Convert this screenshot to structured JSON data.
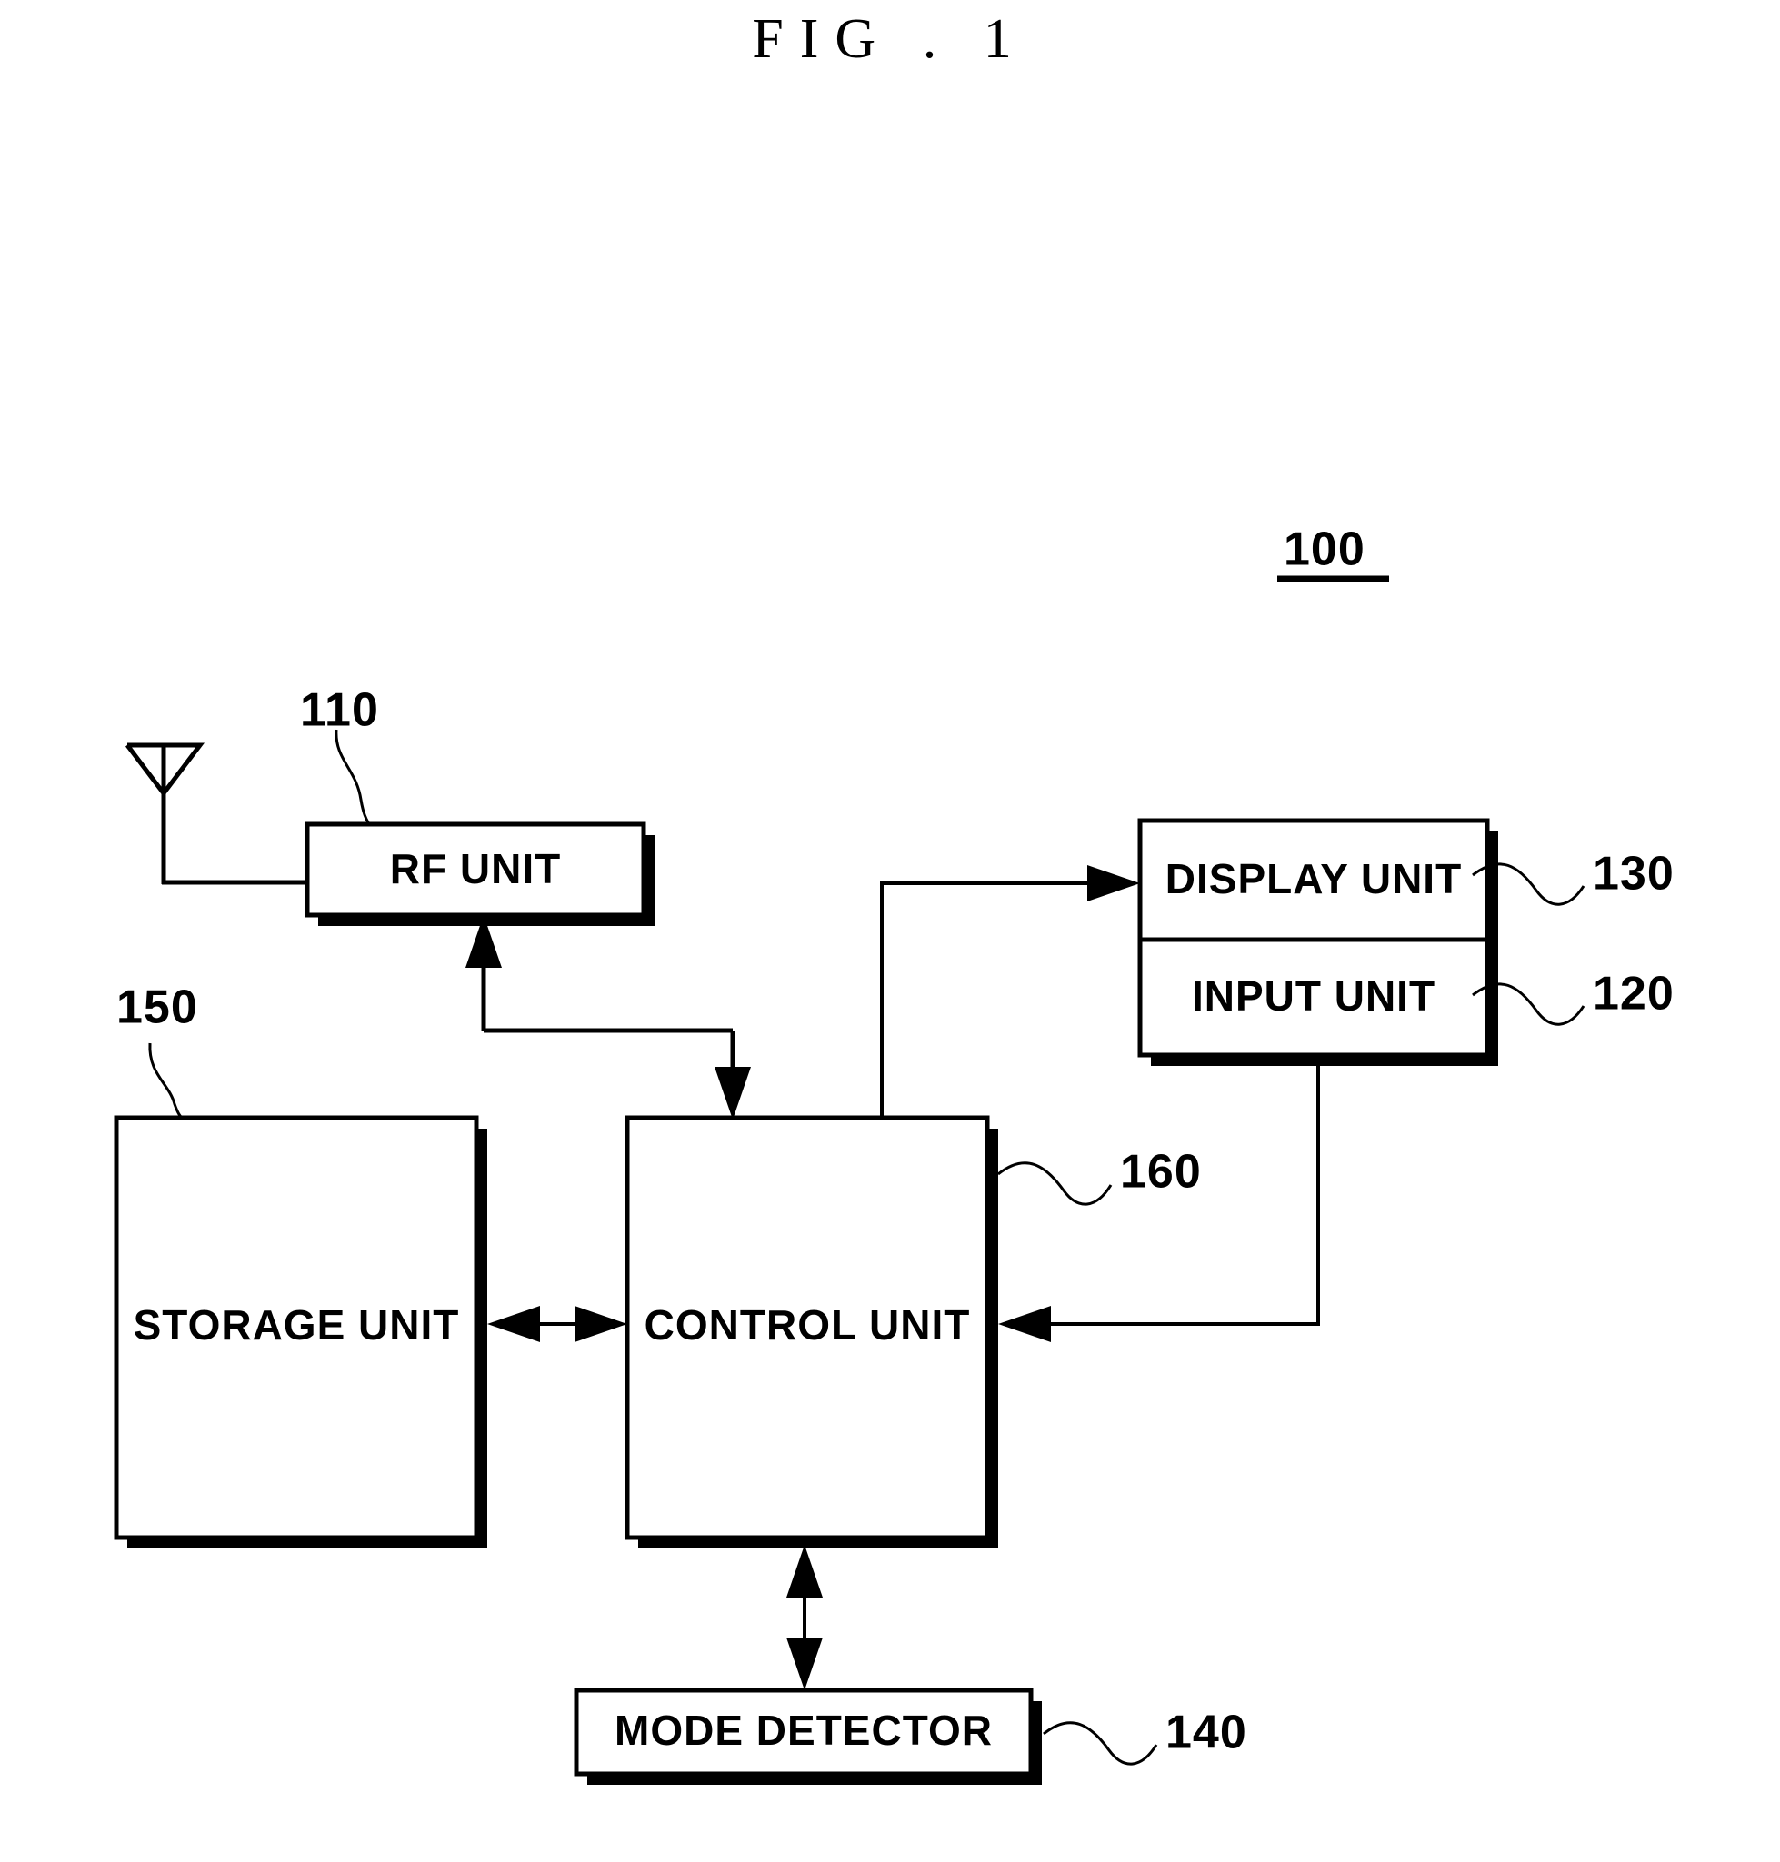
{
  "figure": {
    "title": "FIG . 1",
    "overall_ref": "100"
  },
  "blocks": [
    {
      "id": "rf",
      "label": "RF UNIT",
      "ref": "110"
    },
    {
      "id": "display",
      "label": "DISPLAY UNIT",
      "ref": "130"
    },
    {
      "id": "input",
      "label": "INPUT UNIT",
      "ref": "120"
    },
    {
      "id": "storage",
      "label": "STORAGE UNIT",
      "ref": "150"
    },
    {
      "id": "control",
      "label": "CONTROL UNIT",
      "ref": "160"
    },
    {
      "id": "mode",
      "label": "MODE DETECTOR",
      "ref": "140"
    }
  ],
  "labels": {
    "rf_unit": "RF UNIT",
    "display_unit": "DISPLAY UNIT",
    "input_unit": "INPUT UNIT",
    "storage_unit": "STORAGE UNIT",
    "control_unit": "CONTROL UNIT",
    "mode_detector": "MODE DETECTOR"
  },
  "refs": {
    "device": "100",
    "rf_unit": "110",
    "input_unit": "120",
    "display_unit": "130",
    "mode_detector": "140",
    "storage_unit": "150",
    "control_unit": "160"
  },
  "icons": {
    "antenna": "antenna-icon"
  },
  "colors": {
    "ink": "#000000",
    "paper": "#ffffff"
  }
}
